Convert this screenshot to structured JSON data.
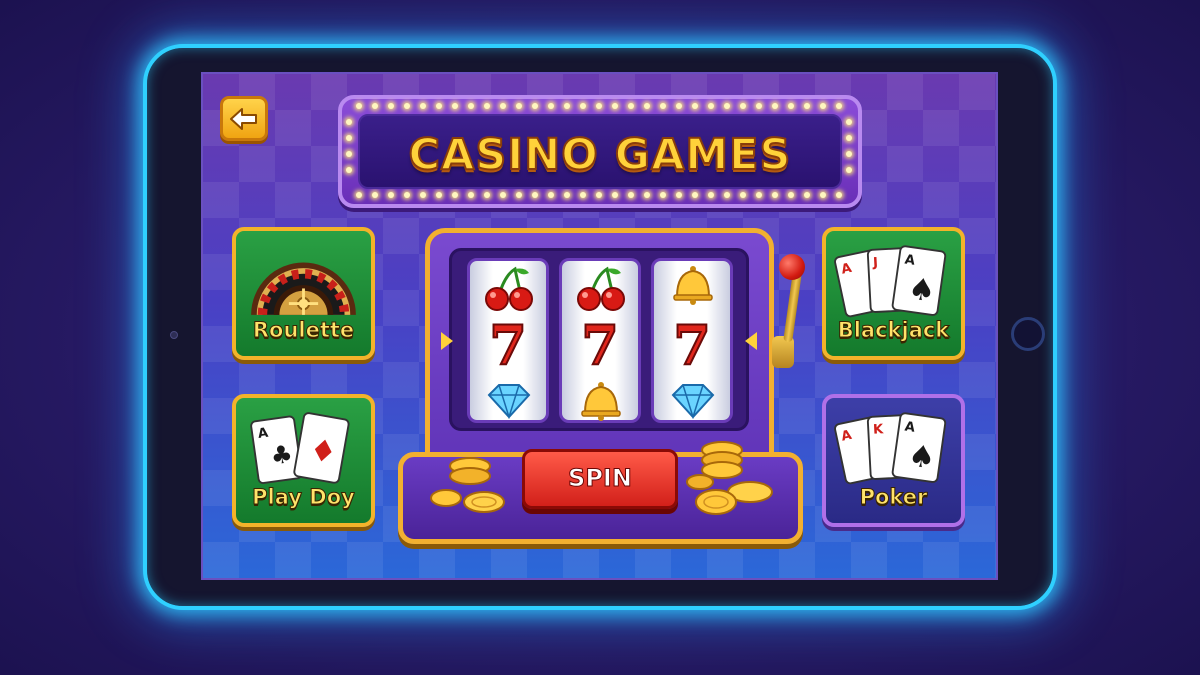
{
  "header": {
    "title": "CASINO GAMES"
  },
  "navigation": {
    "back_icon": "arrow-left-icon"
  },
  "games": [
    {
      "id": "roulette",
      "label": "Roulette",
      "icon": "roulette-wheel-icon"
    },
    {
      "id": "play-doy",
      "label": "Play Doy",
      "icon": "playing-cards-icon"
    },
    {
      "id": "blackjack",
      "label": "Blackjack",
      "icon": "blackjack-cards-icon"
    },
    {
      "id": "poker",
      "label": "Poker",
      "icon": "poker-cards-icon"
    }
  ],
  "slot_machine": {
    "spin_label": "SPIN",
    "reels": [
      [
        "cherries",
        "7",
        "diamond"
      ],
      [
        "cherries",
        "7",
        "bell"
      ],
      [
        "bell",
        "7",
        "diamond"
      ]
    ],
    "seven_symbol": "7",
    "card_ranks": {
      "play_doy": [
        "A"
      ],
      "blackjack": [
        "A",
        "J",
        "A"
      ],
      "poker": [
        "A",
        "K",
        "A"
      ]
    }
  },
  "colors": {
    "frame_glow": "#2fd0ff",
    "title_gold": "#ffd23a",
    "tile_border": "#f3b32a",
    "spin_red": "#d2201a"
  }
}
